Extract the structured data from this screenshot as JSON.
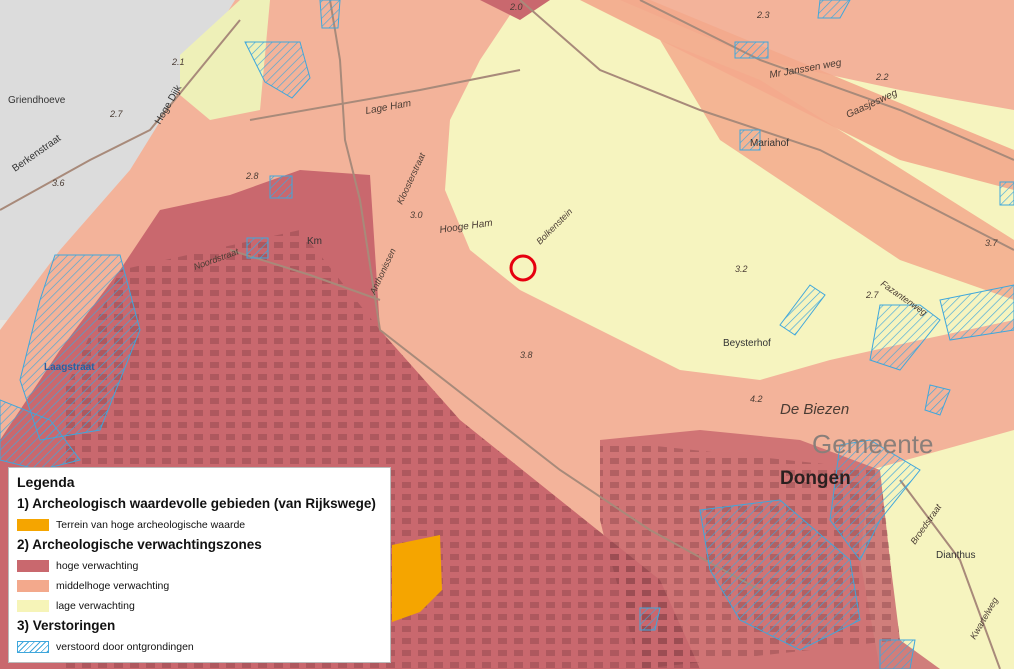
{
  "map": {
    "labels": {
      "griendhoeve": "Griendhoeve",
      "berkenstraat": "Berkenstraat",
      "hoge_dijk": "Hoge Dijk",
      "lage_ham": "Lage Ham",
      "kloosterstraat": "Kloosterstraat",
      "hooge_ham": "Hooge Ham",
      "bolkenstein": "Bolkenstein",
      "mr_janssenweg": "Mr Janssen weg",
      "gaasjesweg": "Gaasjesweg",
      "marianhof": "Mariahof",
      "beysterhof": "Beysterhof",
      "de_biezen": "De Biezen",
      "gemeente": "Gemeente",
      "dongen": "Dongen",
      "laagstraat": "Laagstraat",
      "noordstraat": "Noordstraat",
      "anthonissen": "Anthonissen",
      "fazantenweg": "Fazantenweg",
      "broedstraat": "Broedstraat",
      "dianthus": "Dianthus",
      "kwartelweg": "Kwartelweg",
      "km": "Km",
      "h21": "2.1",
      "h27a": "2.7",
      "h36": "3.6",
      "h28": "2.8",
      "h30": "3.0",
      "h20": "2.0",
      "h23": "2.3",
      "h22": "2.2",
      "h38": "3.8",
      "h42": "4.2",
      "h32": "3.2",
      "h27b": "2.7",
      "h37": "3.7"
    }
  },
  "legend": {
    "title": "Legenda",
    "section1": "1) Archeologisch waardevolle gebieden (van Rijkswege)",
    "item_hoog_waarde": "Terrein van hoge archeologische waarde",
    "section2": "2) Archeologische verwachtingszones",
    "item_hoge": "hoge verwachting",
    "item_middel": "middelhoge verwachting",
    "item_lage": "lage verwachting",
    "section3": "3) Verstoringen",
    "item_verstoord": "verstoord door ontgrondingen",
    "colors": {
      "hoog_waarde": "#f5a500",
      "hoge": "#c9686e",
      "middel": "#f3a98c",
      "lage": "#f6f4b8",
      "verstoord": "#3fa7dc"
    }
  }
}
